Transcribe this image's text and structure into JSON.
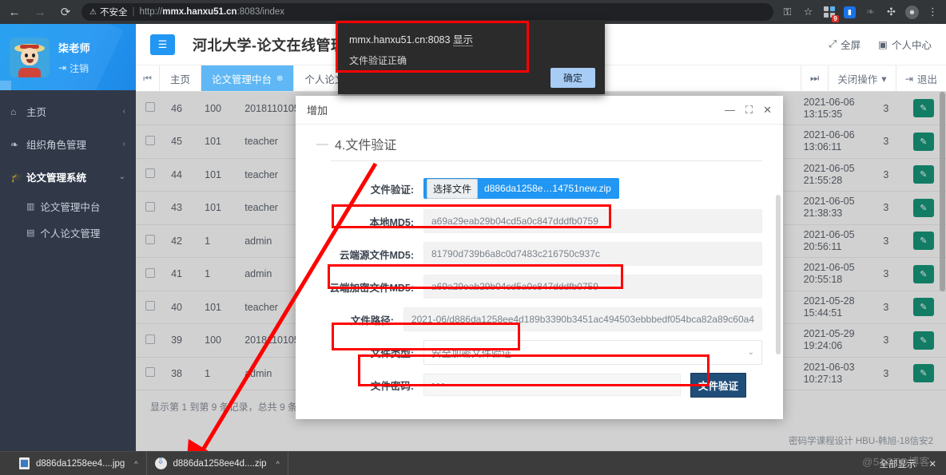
{
  "browser": {
    "back_icon": "←",
    "forward_icon": "→",
    "reload_icon": "⟳",
    "insecure_icon": "⚠",
    "insecure_label": "不安全",
    "url_prefix": "http://",
    "url_host": "mmx.hanxu51.cn",
    "url_rest": ":8083/index",
    "icons": {
      "key": "key-icon",
      "star": "☆",
      "extensions_badge": "9",
      "bookmark_glyph": "▮",
      "evernote_glyph": "❧",
      "puzzle_glyph": "🧩",
      "avatar_glyph": "●",
      "menu_glyph": "⋮"
    }
  },
  "alert": {
    "origin": "mmx.hanxu51.cn:8083 ",
    "origin_suffix": "显示",
    "message": "文件验证正确",
    "ok_label": "确定"
  },
  "sidebar": {
    "user_name": "柒老师",
    "logout_label": "注销",
    "logout_icon": "⇥",
    "items": [
      {
        "label": "主页",
        "icon": "⌂",
        "arrow": "‹",
        "active": false
      },
      {
        "label": "组织角色管理",
        "icon": "❧",
        "arrow": "‹",
        "active": false
      },
      {
        "label": "论文管理系统",
        "icon": "🎓",
        "arrow": "⌄",
        "active": true
      }
    ],
    "sub_items": [
      {
        "label": "论文管理中台",
        "icon": "▥"
      },
      {
        "label": "个人论文管理",
        "icon": "▤"
      }
    ]
  },
  "header": {
    "menu_icon": "☰",
    "title": "河北大学-论文在线管理",
    "fullscreen_label": "全屏",
    "fullscreen_icon": "⤢",
    "profile_label": "个人中心",
    "profile_icon": "▣"
  },
  "tabbar": {
    "left_arrow": "⏮",
    "tabs": [
      {
        "label": "主页",
        "active": false,
        "closable": false
      },
      {
        "label": "论文管理中台",
        "active": true,
        "closable": true,
        "close_icon": "⊗"
      },
      {
        "label": "个人论文管理",
        "active": false,
        "closable": true,
        "close_icon": "⊗"
      }
    ],
    "right_arrow": "⏭",
    "close_ops_label": "关闭操作",
    "close_ops_caret": "▾",
    "exit_label": "退出",
    "exit_icon": "⇥"
  },
  "table": {
    "rows": [
      {
        "id": "46",
        "uid": "100",
        "user": "2018110105",
        "date1": "2021-06-06",
        "date2": "13:15:35",
        "num": "3"
      },
      {
        "id": "45",
        "uid": "101",
        "user": "teacher",
        "date1": "2021-06-06",
        "date2": "13:06:11",
        "num": "3"
      },
      {
        "id": "44",
        "uid": "101",
        "user": "teacher",
        "date1": "2021-06-05",
        "date2": "21:55:28",
        "num": "3"
      },
      {
        "id": "43",
        "uid": "101",
        "user": "teacher",
        "date1": "2021-06-05",
        "date2": "21:38:33",
        "num": "3"
      },
      {
        "id": "42",
        "uid": "1",
        "user": "admin",
        "date1": "2021-06-05",
        "date2": "20:56:11",
        "num": "3"
      },
      {
        "id": "41",
        "uid": "1",
        "user": "admin",
        "date1": "2021-06-05",
        "date2": "20:55:18",
        "num": "3"
      },
      {
        "id": "40",
        "uid": "101",
        "user": "teacher",
        "date1": "2021-05-28",
        "date2": "15:44:51",
        "num": "3"
      },
      {
        "id": "39",
        "uid": "100",
        "user": "2018110105",
        "date1": "2021-05-29",
        "date2": "19:24:06",
        "num": "3"
      },
      {
        "id": "38",
        "uid": "1",
        "user": "admin",
        "date1": "2021-06-03",
        "date2": "10:27:13",
        "num": "3"
      }
    ],
    "edit_icon": "✎",
    "summary": "显示第 1 到第 9 条记录，总共 9 条记录"
  },
  "footer_note": "密码学课程设计 HBU-韩旭-18信安2",
  "modal": {
    "title": "增加",
    "minimize_icon": "—",
    "maximize_icon": "⛶",
    "close_icon": "✕",
    "section_dash": "—",
    "section_title": "4.文件验证",
    "fields": {
      "file_verify_label": "文件验证:",
      "choose_file_button": "选择文件",
      "chosen_file_name": "d886da1258e…14751new.zip",
      "local_md5_label": "本地MD5:",
      "local_md5_value": "a69a29eab29b04cd5a0c847dddfb0759",
      "cloud_src_md5_label": "云端源文件MD5:",
      "cloud_src_md5_value": "81790d739b6a8c0d7483c216750c937c",
      "cloud_enc_md5_label": "云端加密文件MD5:",
      "cloud_enc_md5_value": "a69a29eab29b04cd5a0c847dddfb0759",
      "file_path_label": "文件路径:",
      "file_path_value": "2021-06/d886da1258ee4d189b3390b3451ac494503ebbbedf054bca82a89c60a4",
      "file_type_label": "文件类型:",
      "file_type_value": "安全加密文件验证",
      "file_type_caret": "⌄",
      "file_pwd_label": "文件密码:",
      "file_pwd_value": "•••",
      "verify_button": "文件验证"
    }
  },
  "downloads": {
    "items": [
      {
        "name": "d886da1258ee4....jpg",
        "type": "jpg",
        "caret": "^"
      },
      {
        "name": "d886da1258ee4d....zip",
        "type": "zip",
        "caret": "^"
      }
    ],
    "show_all_label": "全部显示",
    "close_icon": "✕"
  },
  "watermark": "@51CTO博客",
  "colors": {
    "accent_blue": "#2196f3",
    "sidebar_dark": "#313949",
    "alert_dark": "#2b2b2b",
    "annotation_red": "#ff0000",
    "edit_green": "#17997a",
    "verify_navy": "#1f4e79"
  }
}
